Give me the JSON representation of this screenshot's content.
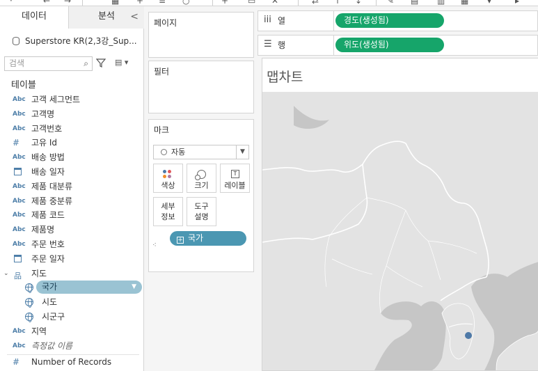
{
  "tabs": {
    "data": "데이터",
    "analytics": "분석",
    "collapse": "<"
  },
  "datasource": {
    "name": "Superstore KR(2,3강_Sup..."
  },
  "search": {
    "placeholder": "검색",
    "icon": "search-icon"
  },
  "sections": {
    "tables": "테이블"
  },
  "fields": [
    {
      "type": "Abc",
      "name": "고객 세그먼트"
    },
    {
      "type": "Abc",
      "name": "고객명"
    },
    {
      "type": "Abc",
      "name": "고객번호"
    },
    {
      "type": "#",
      "name": "고유 Id"
    },
    {
      "type": "Abc",
      "name": "배송 방법"
    },
    {
      "type": "date",
      "name": "배송 일자"
    },
    {
      "type": "Abc",
      "name": "제품 대분류"
    },
    {
      "type": "Abc",
      "name": "제품 중분류"
    },
    {
      "type": "Abc",
      "name": "제품 코드"
    },
    {
      "type": "Abc",
      "name": "제품명"
    },
    {
      "type": "Abc",
      "name": "주문 번호"
    },
    {
      "type": "date",
      "name": "주문 일자"
    }
  ],
  "hierarchy": {
    "name": "지도",
    "children": [
      {
        "name": "국가",
        "selected": true
      },
      {
        "name": "시도"
      },
      {
        "name": "시군구"
      }
    ]
  },
  "fields_after": [
    {
      "type": "Abc",
      "name": "지역"
    },
    {
      "type": "Abc",
      "name": "측정값 이름",
      "italic": true
    }
  ],
  "measures": [
    {
      "type": "#",
      "name": "Number of Records"
    }
  ],
  "cards": {
    "pages": "페이지",
    "filters": "필터",
    "marks": "마크",
    "mark_type": "자동",
    "buttons": {
      "color": "색상",
      "size": "크기",
      "label": "레이블",
      "label_icon": "T",
      "detail_1": "세부",
      "detail_2": "정보",
      "tooltip_1": "도구",
      "tooltip_2": "설명"
    },
    "detail_pill": "국가"
  },
  "shelves": {
    "columns": {
      "label": "열",
      "pill": "경도(생성됨)"
    },
    "rows": {
      "label": "행",
      "pill": "위도(생성됨)"
    }
  },
  "viz": {
    "title": "맵차트"
  },
  "colors": {
    "accent_green": "#16a56a",
    "pill_blue": "#4b97b2",
    "pill_selected": "#9ac3d3",
    "map_land": "#e3e3e3",
    "map_water": "#c6c6c6",
    "mark_dot": "#4e79a7"
  }
}
